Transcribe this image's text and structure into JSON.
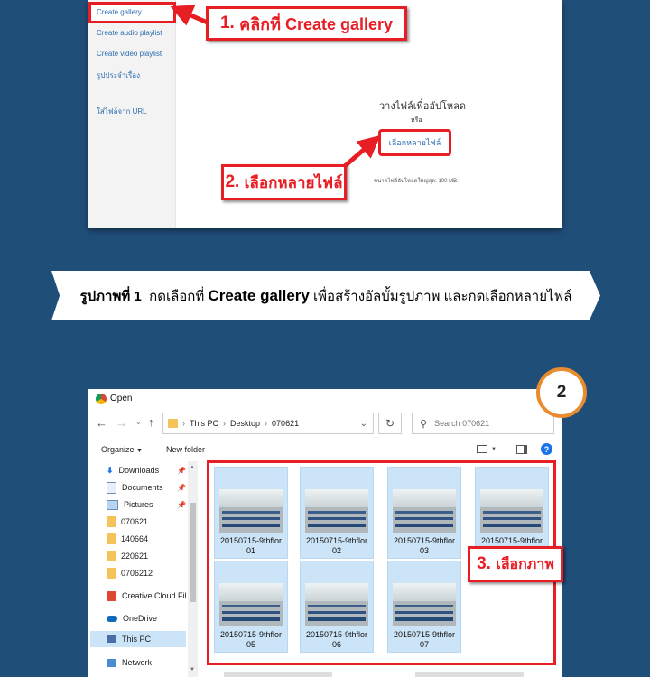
{
  "panel1": {
    "menu": [
      "Create gallery",
      "Create audio playlist",
      "Create video playlist",
      "รูปประจำเรื่อง",
      "ใส่ไฟล์จาก URL"
    ],
    "drop_text": "วางไฟล์เพื่ออัปโหลด",
    "or_text": "หรือ",
    "select_button": "เลือกหลายไฟล์",
    "max_size": "ขนาดไฟล์อัปโหลดใหญ่สุด: 100 MB.",
    "callout1_num": "1.",
    "callout1_text": "คลิกที่ Create gallery",
    "callout2_num": "2.",
    "callout2_text": "เลือกหลายไฟล์"
  },
  "caption": {
    "prefix": "รูปภาพที่ 1",
    "mid": "กดเลือกที่",
    "strong": "Create gallery",
    "suffix": "เพื่อสร้างอัลบั้มรูปภาพ และกดเลือกหลายไฟล์"
  },
  "badge": "2",
  "dialog": {
    "title": "Open",
    "breadcrumb": [
      "This PC",
      "Desktop",
      "070621"
    ],
    "search_placeholder": "Search 070621",
    "organize": "Organize",
    "new_folder": "New folder",
    "nav": [
      {
        "label": "Downloads",
        "icon": "download-icon",
        "pinned": true
      },
      {
        "label": "Documents",
        "icon": "document-icon",
        "pinned": true
      },
      {
        "label": "Pictures",
        "icon": "pictures-icon",
        "pinned": true
      },
      {
        "label": "070621",
        "icon": "folder-icon"
      },
      {
        "label": "140664",
        "icon": "folder-icon"
      },
      {
        "label": "220621",
        "icon": "folder-icon"
      },
      {
        "label": "0706212",
        "icon": "folder-icon"
      },
      {
        "label": "Creative Cloud Fil",
        "icon": "creative-cloud-icon"
      },
      {
        "label": "OneDrive",
        "icon": "onedrive-icon"
      },
      {
        "label": "This PC",
        "icon": "pc-icon",
        "selected": true
      },
      {
        "label": "Network",
        "icon": "network-icon"
      }
    ],
    "files": [
      {
        "line1": "20150715-9thflor",
        "line2": "01"
      },
      {
        "line1": "20150715-9thflor",
        "line2": "02"
      },
      {
        "line1": "20150715-9thflor",
        "line2": "03"
      },
      {
        "line1": "20150715-9thflor",
        "line2": ""
      },
      {
        "line1": "20150715-9thflor",
        "line2": "05"
      },
      {
        "line1": "20150715-9thflor",
        "line2": "06"
      },
      {
        "line1": "20150715-9thflor",
        "line2": "07"
      }
    ],
    "callout3_num": "3.",
    "callout3_text": "เลือกภาพ"
  },
  "colors": {
    "background": "#1f4e79",
    "accent_red": "#e81e25",
    "badge_ring": "#e98b2f",
    "selection": "#cce4f7",
    "link_blue": "#2b6cb0"
  }
}
